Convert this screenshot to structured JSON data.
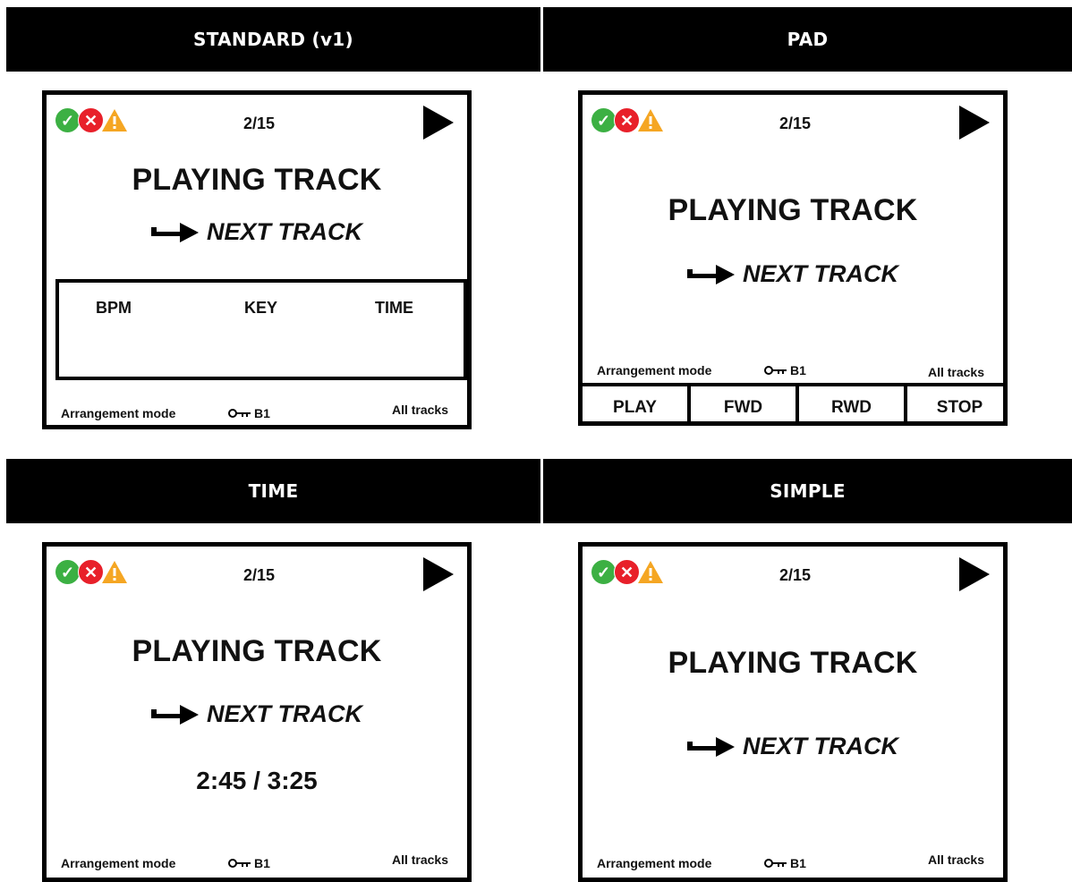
{
  "screen": {
    "counter": "2/15",
    "playing_track": "PLAYING TRACK",
    "next_track": "NEXT TRACK",
    "mode": "Arrangement mode",
    "key_value": "B1",
    "scope": "All tracks"
  },
  "panels": {
    "standard": {
      "header": "STANDARD (v1)",
      "columns": [
        "BPM",
        "KEY",
        "TIME"
      ]
    },
    "pad": {
      "header": "PAD",
      "buttons": [
        "PLAY",
        "FWD",
        "RWD",
        "STOP"
      ]
    },
    "time": {
      "header": "TIME",
      "position": "2:45 / 3:25"
    },
    "simple": {
      "header": "SIMPLE"
    }
  },
  "icons": [
    "check-circle-icon",
    "error-circle-icon",
    "warning-triangle-icon",
    "play-icon",
    "arrow-right-icon",
    "key-icon"
  ],
  "colors": {
    "header_bg": "#000000",
    "ok": "#3cb043",
    "error": "#e8202a",
    "warning": "#f5a623"
  }
}
